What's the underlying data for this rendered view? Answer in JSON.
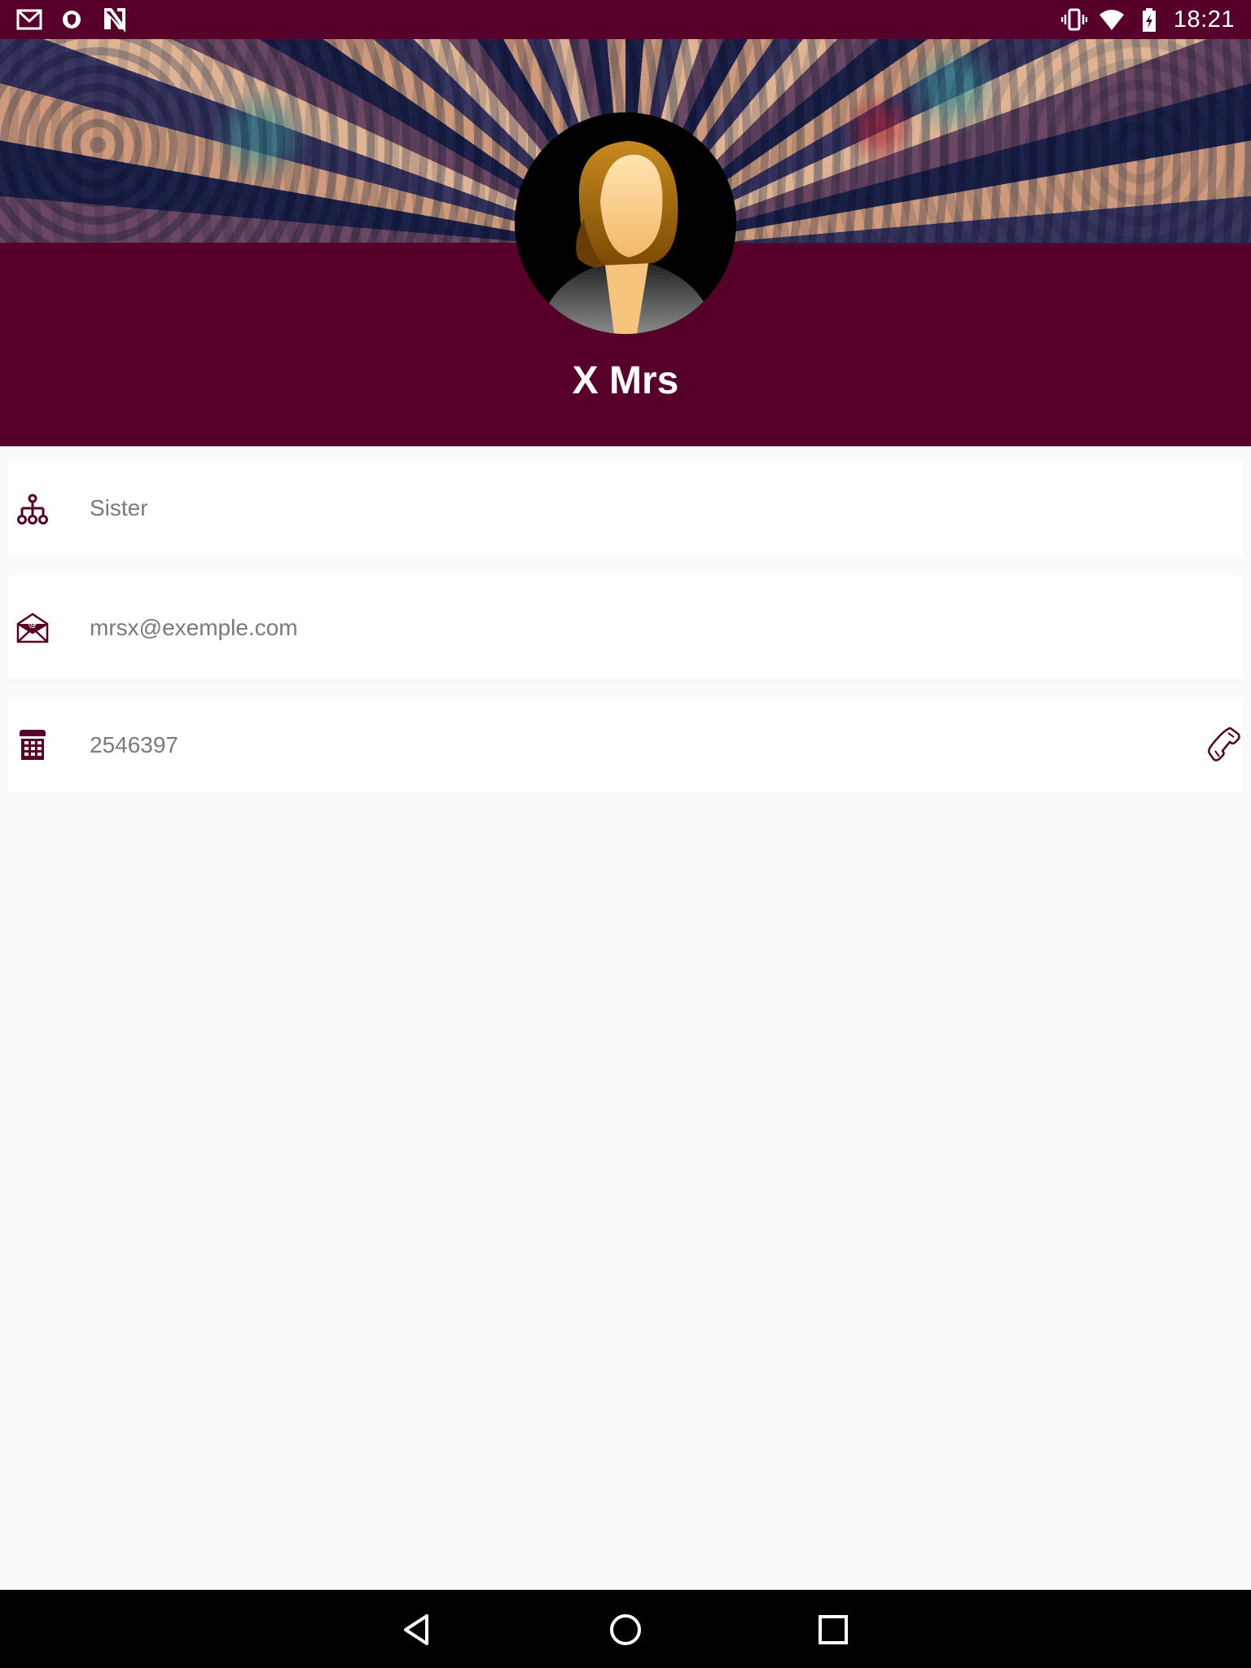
{
  "colors": {
    "primary": "#57002a",
    "background": "#fafafa",
    "card": "#ffffff",
    "secondary_text": "#7a7a7a"
  },
  "status_bar": {
    "time": "18:21",
    "left_icons": [
      "gmail-icon",
      "shield-icon",
      "n-app-icon"
    ],
    "right_icons": [
      "vibrate-icon",
      "wifi-icon",
      "battery-charging-icon"
    ]
  },
  "profile": {
    "name": "X Mrs"
  },
  "details": [
    {
      "icon": "org-chart-icon",
      "value": "Sister"
    },
    {
      "icon": "envelope-at-icon",
      "value": "mrsx@exemple.com"
    },
    {
      "icon": "keypad-phone-icon",
      "value": "2546397",
      "action_icon": "call-handset-icon"
    }
  ],
  "nav_bar": {
    "buttons": [
      "back-icon",
      "home-icon",
      "recents-icon"
    ]
  }
}
